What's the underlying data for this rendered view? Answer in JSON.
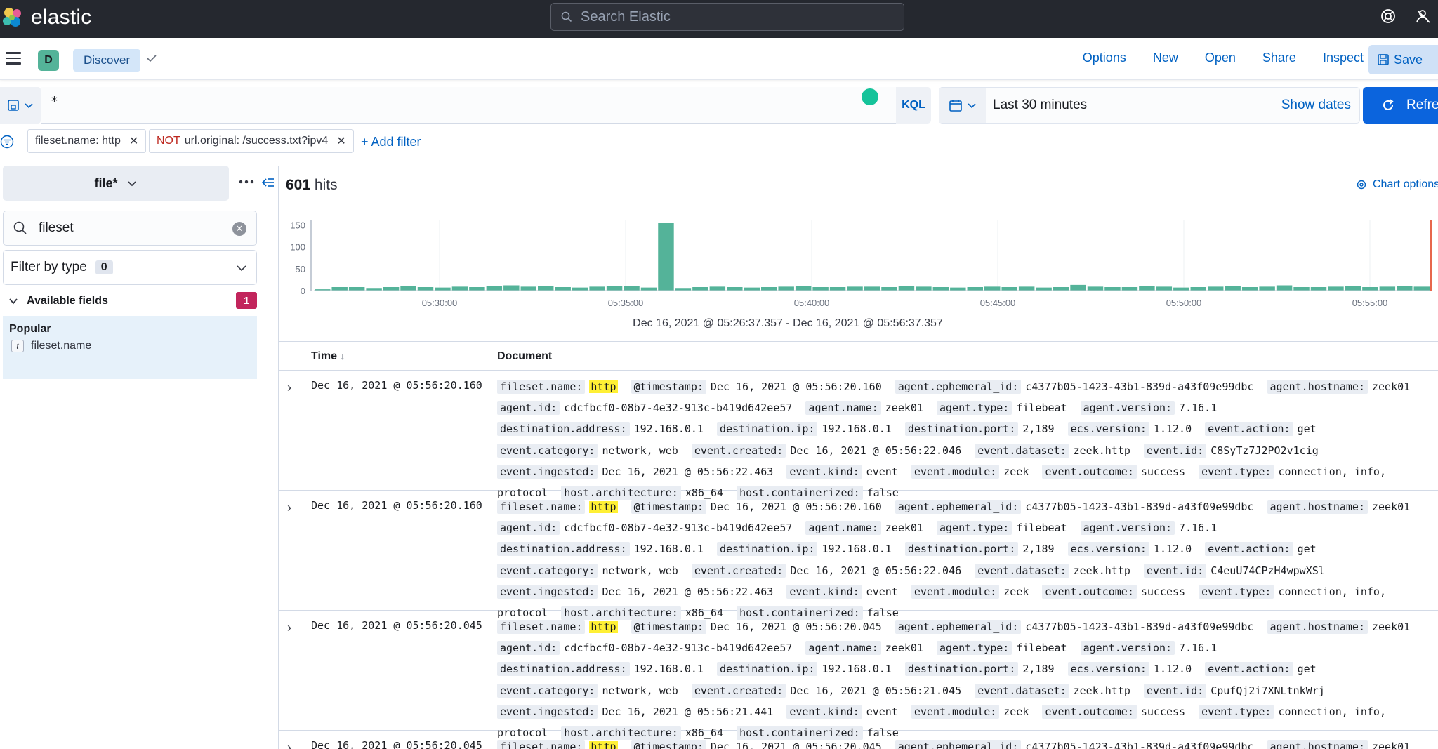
{
  "header": {
    "brand": "elastic",
    "search_placeholder": "Search Elastic"
  },
  "appbar": {
    "space_initial": "D",
    "breadcrumb": "Discover",
    "menu": [
      "Options",
      "New",
      "Open",
      "Share",
      "Inspect"
    ],
    "save_label": "Save"
  },
  "query": {
    "value": "*",
    "language": "KQL",
    "date_range": "Last 30 minutes",
    "show_dates": "Show dates",
    "refresh_label": "Refresh"
  },
  "filters": {
    "pill1": "fileset.name: http",
    "pill2_negate": "NOT",
    "pill2": "url.original: /success.txt?ipv4",
    "add_filter": "+ Add filter"
  },
  "sidebar": {
    "index_pattern": "file*",
    "field_search": "fileset",
    "filter_by_type": "Filter by type",
    "filter_count": "0",
    "available_fields": "Available fields",
    "available_count": "1",
    "popular_title": "Popular",
    "popular_field": "fileset.name",
    "field_type_token": "t"
  },
  "main": {
    "hits_count": "601",
    "hits_label": "hits",
    "chart_options": "Chart options",
    "time_range": "Dec 16, 2021 @ 05:26:37.357 - Dec 16, 2021 @ 05:56:37.357",
    "col_time": "Time",
    "col_document": "Document"
  },
  "chart_data": {
    "type": "bar",
    "y_ticks": [
      0,
      50,
      100,
      150
    ],
    "ylim": [
      0,
      160
    ],
    "x_ticks": [
      "05:30:00",
      "05:35:00",
      "05:40:00",
      "05:45:00",
      "05:50:00",
      "05:55:00"
    ],
    "bar_color": "#54b399",
    "values": [
      3,
      8,
      8,
      6,
      8,
      10,
      8,
      7,
      9,
      8,
      10,
      12,
      9,
      10,
      8,
      7,
      9,
      11,
      10,
      7,
      155,
      6,
      8,
      9,
      8,
      7,
      8,
      9,
      11,
      8,
      8,
      9,
      9,
      8,
      10,
      9,
      8,
      7,
      8,
      9,
      8,
      9,
      7,
      8,
      13,
      9,
      8,
      8,
      10,
      9,
      7,
      8,
      9,
      10,
      8,
      9,
      12,
      8,
      8,
      9,
      10,
      8,
      9,
      10,
      9
    ]
  },
  "rows": [
    {
      "time": "Dec 16, 2021 @ 05:56:20.160",
      "event_id": "C8SyTz7J2PO2v1cig",
      "created": "05:56:22.046",
      "ingested": "Dec 16, 2021 @ 05:56:22.463",
      "timestamp": "Dec 16, 2021 @ 05:56:20.160"
    },
    {
      "time": "Dec 16, 2021 @ 05:56:20.160",
      "event_id": "C4euU74CPzH4wpwXSl",
      "created": "05:56:22.046",
      "ingested": "Dec 16, 2021 @ 05:56:22.463",
      "timestamp": "Dec 16, 2021 @ 05:56:20.160"
    },
    {
      "time": "Dec 16, 2021 @ 05:56:20.045",
      "event_id": "CpufQj2i7XNLtnkWrj",
      "created": "05:56:21.045",
      "ingested": "Dec 16, 2021 @ 05:56:21.441",
      "timestamp": "Dec 16, 2021 @ 05:56:20.045"
    },
    {
      "time": "Dec 16, 2021 @ 05:56:20.045",
      "event_id": "",
      "created": "",
      "ingested": "",
      "timestamp": "Dec 16, 2021 @ 05:56:20.045"
    }
  ],
  "doc_common": {
    "fileset_name": "http",
    "ephemeral_id": "c4377b05-1423-43b1-839d-a43f09e99dbc",
    "hostname": "zeek01",
    "agent_id": "cdcfbcf0-08b7-4e32-913c-b419d642ee57",
    "agent_name": "zeek01",
    "agent_type": "filebeat",
    "agent_version": "7.16.1",
    "dest_address": "192.168.0.1",
    "dest_ip": "192.168.0.1",
    "dest_port": "2,189",
    "ecs_version": "1.12.0",
    "event_action": "get",
    "event_category": "network, web",
    "created_prefix": "Dec 16,",
    "created_date": "2021 @",
    "event_dataset": "zeek.http",
    "event_kind": "event",
    "event_module": "zeek",
    "event_outcome": "success",
    "event_type": "connection, info, protocol",
    "host_arch": "x86_64",
    "host_containerized": "false"
  },
  "colors": {
    "header_bg": "#25282f",
    "accent": "#0061c2",
    "refresh_bg": "#0b64dd",
    "bar": "#54b399",
    "badge": "#c2255c",
    "highlight": "#fff035"
  }
}
